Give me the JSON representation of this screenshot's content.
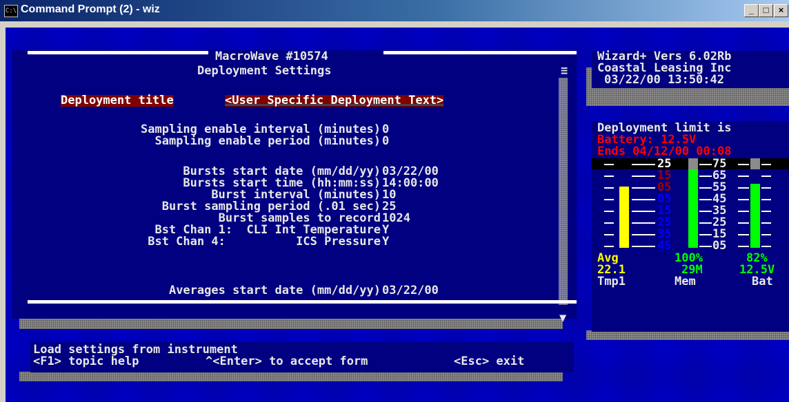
{
  "window": {
    "title": "Command Prompt (2) - wiz",
    "icon": "cmd-icon",
    "controls": {
      "minimize": "_",
      "maximize": "□",
      "close": "×"
    }
  },
  "form": {
    "device": "MacroWave #10574",
    "title": "Deployment Settings",
    "scroll_menu_glyph": "≡",
    "scroll_down_glyph": "▼",
    "deployment_title_label": "Deployment title",
    "deployment_title_value": "<User Specific Deployment Text>",
    "rows": [
      {
        "label": "Sampling enable interval (minutes)",
        "value": "0"
      },
      {
        "label": "Sampling enable period (minutes)",
        "value": "0"
      },
      {
        "label": "Bursts start date (mm/dd/yy)",
        "value": "03/22/00"
      },
      {
        "label": "Bursts start time (hh:mm:ss)",
        "value": "14:00:00"
      },
      {
        "label": "Burst interval (minutes)",
        "value": "10"
      },
      {
        "label": "Burst sampling period (.01 sec)",
        "value": "25"
      },
      {
        "label": "Burst samples to record",
        "value": "1024"
      },
      {
        "label": "Bst Chan 1:  CLI Int Temperature",
        "value": "Y"
      },
      {
        "label": "Bst Chan 4:          ICS Pressure",
        "value": "Y"
      },
      {
        "label": "Averages start date (mm/dd/yy)",
        "value": "03/22/00"
      }
    ]
  },
  "info": {
    "version": "Wizard+ Vers 6.02Rb",
    "company": "Coastal Leasing Inc",
    "datetime": "03/22/00 13:50:42"
  },
  "limits": {
    "header": "Deployment limit is",
    "battery": "Battery: 12.5V",
    "ends": "Ends 04/12/00 00:08",
    "scale_left": [
      "25",
      "15",
      "05",
      "05",
      "15",
      "25",
      "35",
      "45"
    ],
    "scale_right": [
      "75",
      "65",
      "55",
      "45",
      "35",
      "25",
      "15",
      "05"
    ],
    "gauges": [
      {
        "name": "Tmp1",
        "top_label": "Avg",
        "value": "22.1",
        "color": "#ffff00",
        "level": 0.78
      },
      {
        "name": "Mem",
        "top_label": "100%",
        "value": "29M",
        "color": "#00ff00",
        "level": 1.0
      },
      {
        "name": "Bat",
        "top_label": "82%",
        "value": "12.5V",
        "color": "#00ff00",
        "level": 0.82
      }
    ],
    "colors": {
      "warm": "#800000",
      "cold": "#0000ff",
      "alert": "#ff0000"
    }
  },
  "status": {
    "line1": "Load settings from instrument",
    "help": "<F1> topic help",
    "accept": "^<Enter> to accept form",
    "exit": "<Esc> exit"
  }
}
